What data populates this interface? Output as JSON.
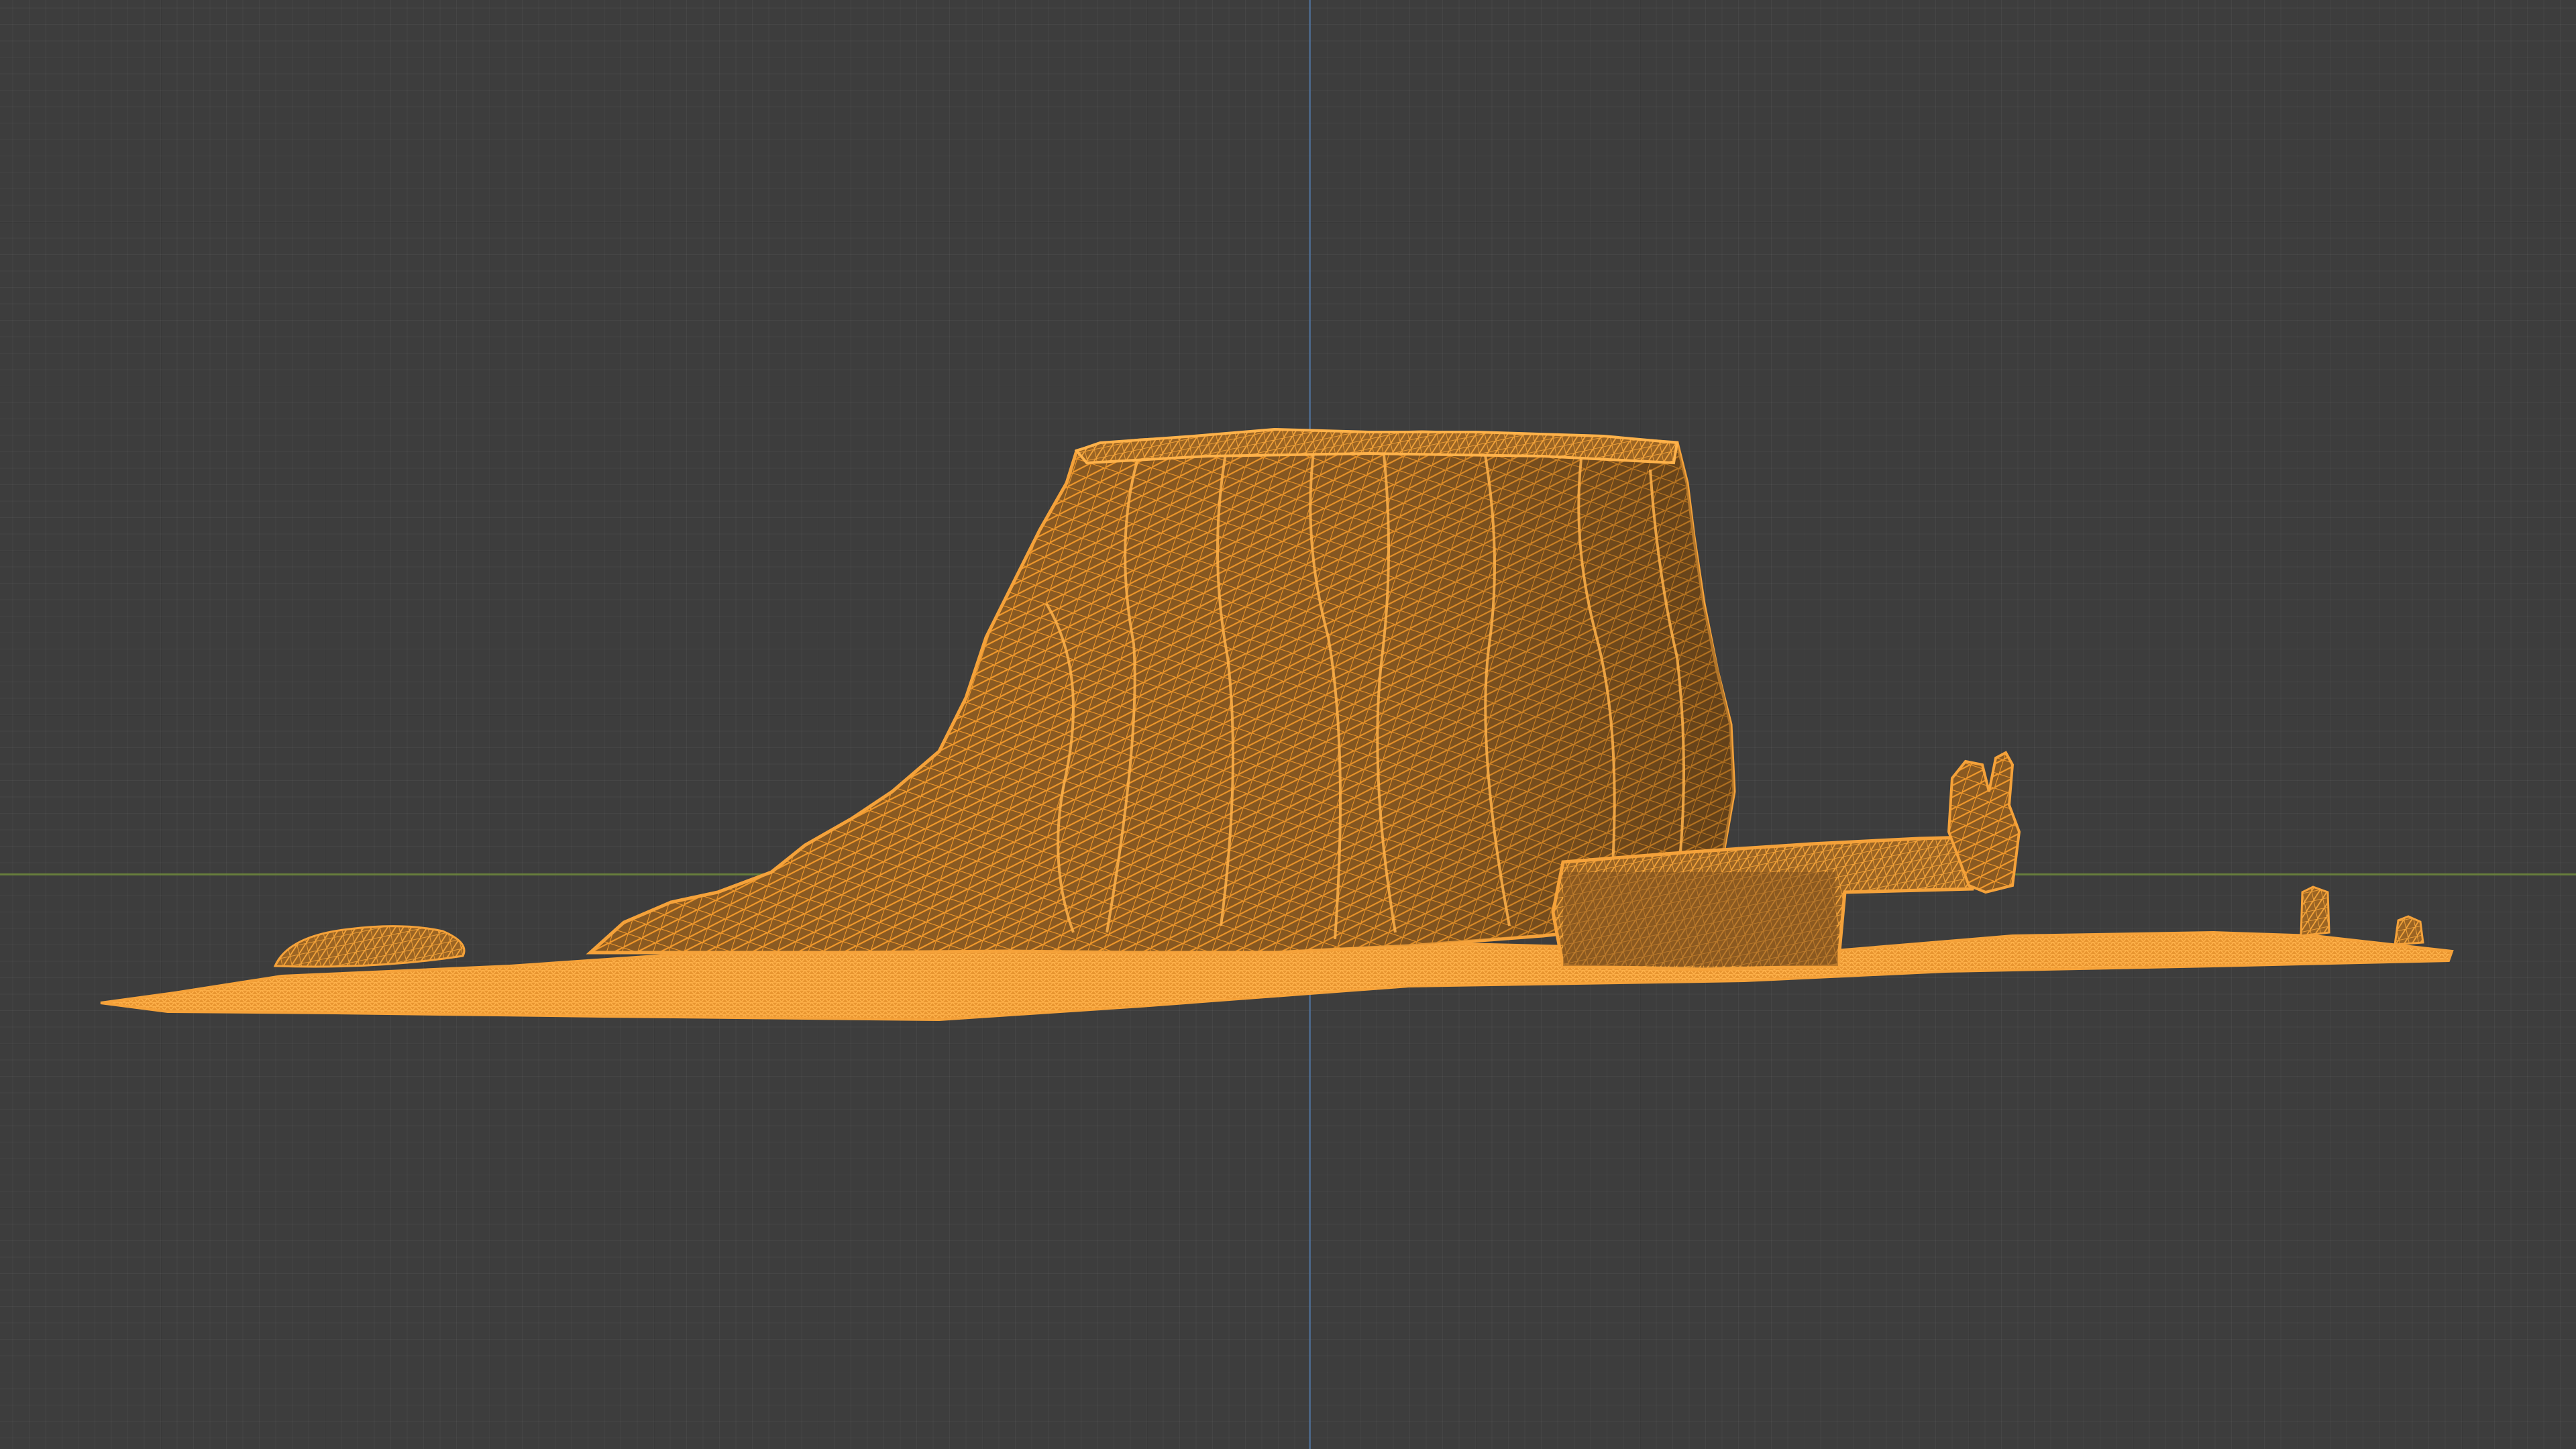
{
  "viewport": {
    "background_color": "#3d3d3d",
    "grid_color": "#474747",
    "x_axis_color": "#6f8a3c",
    "z_axis_color": "#4f6f96",
    "mesh_color": "#f0962a",
    "mesh_display": "wireframe",
    "mesh_object": "rock-formation-scan"
  }
}
